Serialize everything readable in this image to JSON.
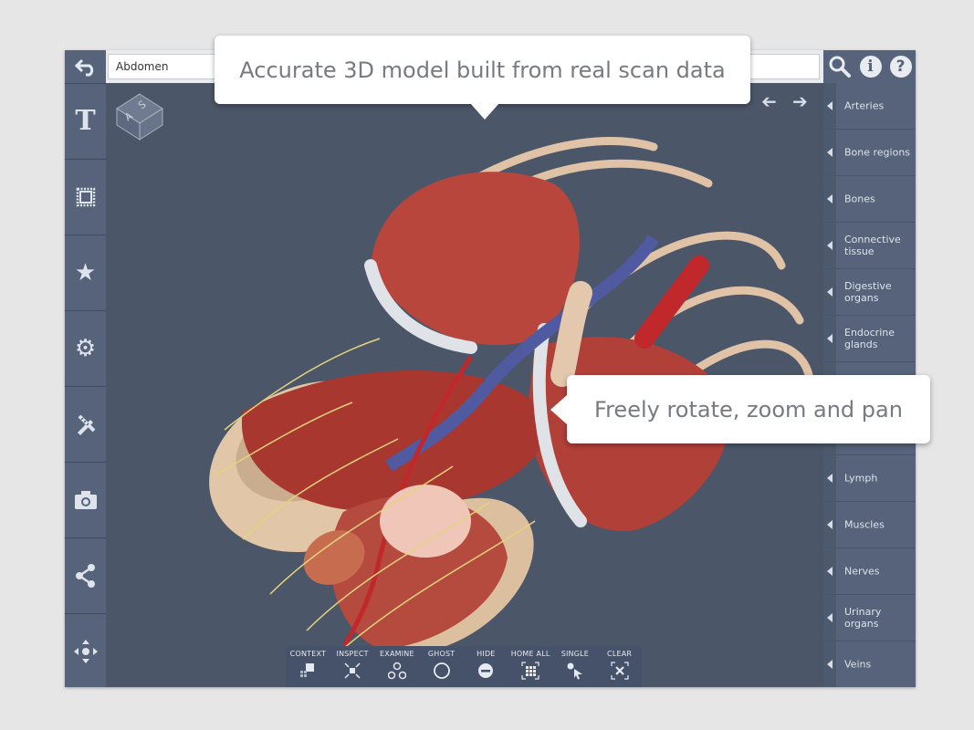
{
  "search": {
    "value": "Abdomen"
  },
  "callouts": {
    "top": "Accurate 3D model built from real scan data",
    "right": "Freely rotate, zoom and pan"
  },
  "orientation_cube": {
    "face1": "A",
    "face2": "S"
  },
  "left_toolbar": [
    {
      "icon": "text-icon",
      "glyph": "T"
    },
    {
      "icon": "stamp-frame-icon",
      "glyph": "▢"
    },
    {
      "icon": "star-icon",
      "glyph": "★"
    },
    {
      "icon": "gear-icon",
      "glyph": "⚙"
    },
    {
      "icon": "pencil-ruler-icon",
      "glyph": "✎"
    },
    {
      "icon": "camera-icon",
      "glyph": "▣"
    },
    {
      "icon": "share-icon",
      "glyph": "∴"
    },
    {
      "icon": "move-icon",
      "glyph": "✥"
    }
  ],
  "top_right_icons": [
    {
      "icon": "search-icon"
    },
    {
      "icon": "info-icon",
      "glyph": "i"
    },
    {
      "icon": "help-icon",
      "glyph": "?"
    }
  ],
  "categories": [
    {
      "label": "Arteries"
    },
    {
      "label": "Bone regions"
    },
    {
      "label": "Bones"
    },
    {
      "label": "Connective tissue"
    },
    {
      "label": "Digestive organs"
    },
    {
      "label": "Endocrine glands"
    },
    {
      "label": ""
    },
    {
      "label": ""
    },
    {
      "label": "Lymph"
    },
    {
      "label": "Muscles"
    },
    {
      "label": "Nerves"
    },
    {
      "label": "Urinary organs"
    },
    {
      "label": "Veins"
    }
  ],
  "bottom_toolbar": [
    {
      "label": "CONTEXT",
      "icon": "context-icon"
    },
    {
      "label": "INSPECT",
      "icon": "inspect-icon"
    },
    {
      "label": "EXAMINE",
      "icon": "examine-icon"
    },
    {
      "label": "GHOST",
      "icon": "ghost-icon"
    },
    {
      "label": "HIDE",
      "icon": "hide-icon"
    },
    {
      "label": "HOME ALL",
      "icon": "home-all-icon"
    },
    {
      "label": "SINGLE",
      "icon": "single-icon"
    },
    {
      "label": "CLEAR",
      "icon": "clear-icon"
    }
  ],
  "colors": {
    "panel": "#56637a",
    "viewport": "#4b5668",
    "muscle": "#b5443c",
    "bone": "#e0c3a6",
    "artery": "#c0282c",
    "vein": "#4f5aa0",
    "nerve": "#e4d47a",
    "cartilage": "#dfe3e8"
  }
}
